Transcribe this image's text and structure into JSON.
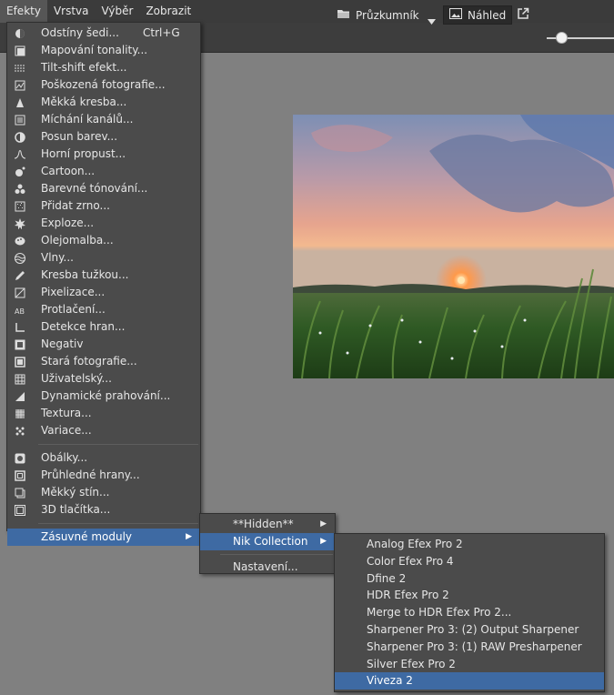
{
  "menubar": {
    "items": [
      {
        "label": "Efekty",
        "active": true
      },
      {
        "label": "Vrstva",
        "active": false
      },
      {
        "label": "Výběr",
        "active": false
      },
      {
        "label": "Zobrazit",
        "active": false
      }
    ]
  },
  "toolbar": {
    "explorer_label": "Průzkumník",
    "preview_label": "Náhled"
  },
  "menu": {
    "items": [
      {
        "label": "Odstíny šedi...",
        "shortcut": "Ctrl+G",
        "icon": "grayscale-icon"
      },
      {
        "label": "Mapování tonality...",
        "icon": "tonemap-icon"
      },
      {
        "label": "Tilt-shift efekt...",
        "icon": "tiltshift-icon"
      },
      {
        "label": "Poškozená fotografie...",
        "icon": "damaged-photo-icon"
      },
      {
        "label": "Měkká kresba...",
        "icon": "soft-drawing-icon"
      },
      {
        "label": "Míchání kanálů...",
        "icon": "channel-mixer-icon"
      },
      {
        "label": "Posun barev...",
        "icon": "color-shift-icon"
      },
      {
        "label": "Horní propust...",
        "icon": "high-pass-icon"
      },
      {
        "label": "Cartoon...",
        "icon": "cartoon-icon"
      },
      {
        "label": "Barevné tónování...",
        "icon": "color-toning-icon"
      },
      {
        "label": "Přidat zrno...",
        "icon": "grain-icon"
      },
      {
        "label": "Exploze...",
        "icon": "explosion-icon"
      },
      {
        "label": "Olejomalba...",
        "icon": "oil-paint-icon"
      },
      {
        "label": "Vlny...",
        "icon": "waves-icon"
      },
      {
        "label": "Kresba tužkou...",
        "icon": "pencil-icon"
      },
      {
        "label": "Pixelizace...",
        "icon": "pixelate-icon"
      },
      {
        "label": "Protlačení...",
        "icon": "emboss-icon"
      },
      {
        "label": "Detekce hran...",
        "icon": "edge-detect-icon"
      },
      {
        "label": "Negativ",
        "icon": "negative-icon"
      },
      {
        "label": "Stará fotografie...",
        "icon": "old-photo-icon"
      },
      {
        "label": "Uživatelský...",
        "icon": "custom-icon"
      },
      {
        "label": "Dynamické prahování...",
        "icon": "threshold-icon"
      },
      {
        "label": "Textura...",
        "icon": "texture-icon"
      },
      {
        "label": "Variace...",
        "icon": "variations-icon"
      }
    ],
    "group2": [
      {
        "label": "Obálky...",
        "icon": "frames-icon"
      },
      {
        "label": "Průhledné hrany...",
        "icon": "transparent-edges-icon"
      },
      {
        "label": "Měkký stín...",
        "icon": "soft-shadow-icon"
      },
      {
        "label": "3D tlačítka...",
        "icon": "3d-button-icon"
      }
    ],
    "plugins_label": "Zásuvné moduly"
  },
  "submenu1": {
    "hidden_label": "**Hidden**",
    "nik_label": "Nik Collection",
    "settings_label": "Nastavení..."
  },
  "submenu2": {
    "items": [
      "Analog Efex Pro 2",
      "Color Efex Pro 4",
      "Dfine 2",
      "HDR Efex Pro 2",
      "Merge to HDR Efex Pro 2...",
      "Sharpener Pro 3: (2) Output Sharpener",
      "Sharpener Pro 3: (1) RAW Presharpener",
      "Silver Efex Pro 2",
      "Viveza 2"
    ],
    "highlighted_index": 8
  },
  "colors": {
    "highlight": "#3e6aa3",
    "menu_bg": "#4b4b4b",
    "canvas_bg": "#808080"
  }
}
